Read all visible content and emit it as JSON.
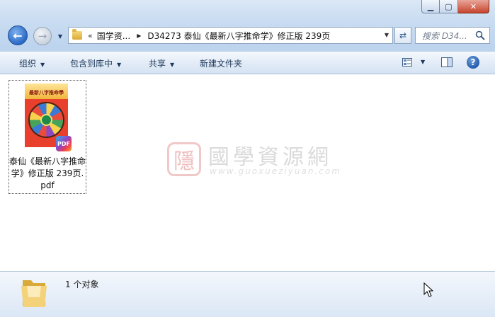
{
  "window": {
    "controls": {
      "minimize": "▁",
      "maximize": "▢",
      "close": "✕"
    }
  },
  "nav": {
    "back_icon": "back-arrow-icon",
    "forward_icon": "forward-arrow-icon"
  },
  "address": {
    "overflow": "«",
    "crumbs": [
      "国学资...",
      "D34273 泰仙《最新八字推命学》修正版 239页"
    ]
  },
  "search": {
    "placeholder": "搜索 D34..."
  },
  "toolbar": {
    "organize": "组织",
    "include_library": "包含到库中",
    "share": "共享",
    "new_folder": "新建文件夹",
    "help": "?"
  },
  "file": {
    "name": "泰仙《最新八字推命学》修正版 239页.pdf",
    "thumb_title": "最新八字推命學",
    "badge": "PDF"
  },
  "watermark": {
    "seal": "隱",
    "title": "國學資源網",
    "url": "www.guoxueziyuan.com"
  },
  "status": {
    "count": "1 个对象"
  },
  "colors": {
    "accent": "#2b69c6",
    "toolbar_text": "#1e395b"
  }
}
